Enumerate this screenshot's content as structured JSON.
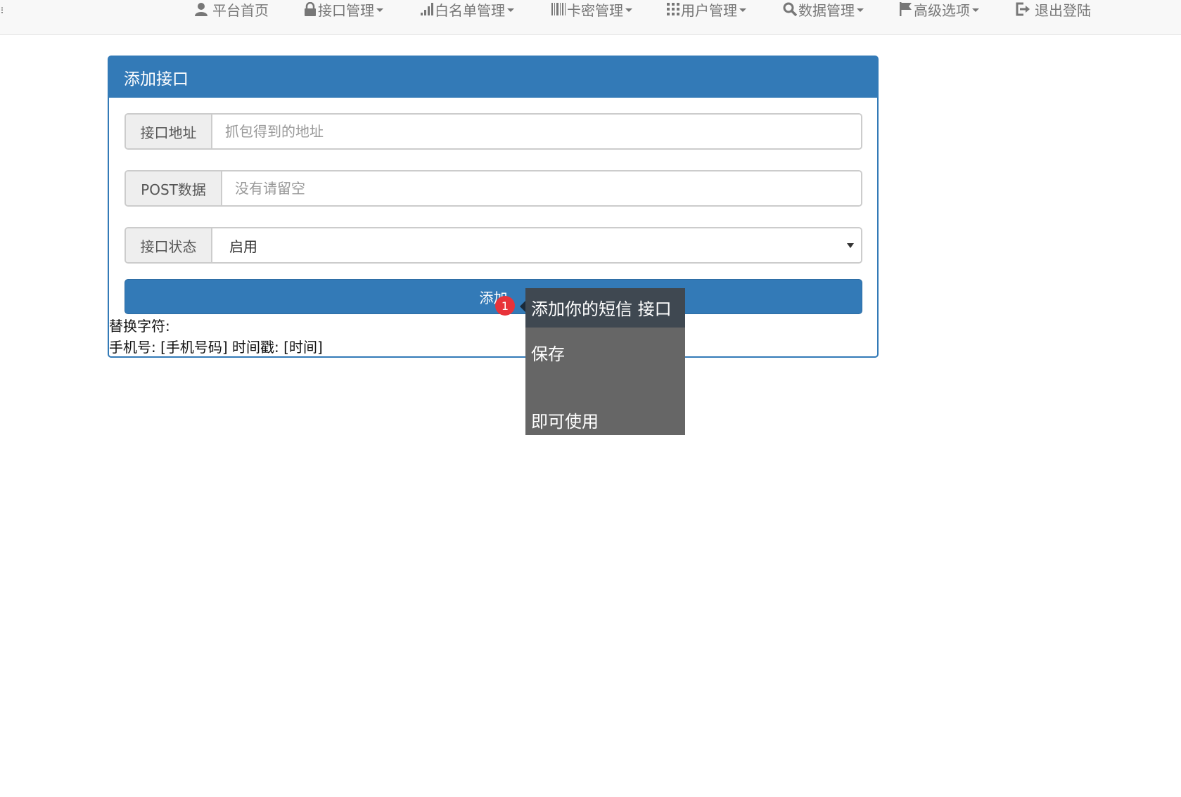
{
  "nav": {
    "items": [
      {
        "label": "平台首页",
        "icon": "user-icon",
        "dropdown": false
      },
      {
        "label": "接口管理",
        "icon": "lock-icon",
        "dropdown": true
      },
      {
        "label": "白名单管理",
        "icon": "signal-icon",
        "dropdown": true
      },
      {
        "label": "卡密管理",
        "icon": "barcode-icon",
        "dropdown": true
      },
      {
        "label": "用户管理",
        "icon": "grid-icon",
        "dropdown": true
      },
      {
        "label": "数据管理",
        "icon": "search-icon",
        "dropdown": true
      },
      {
        "label": "高级选项",
        "icon": "flag-icon",
        "dropdown": true
      },
      {
        "label": "退出登陆",
        "icon": "logout-icon",
        "dropdown": false
      }
    ]
  },
  "panel": {
    "title": "添加接口",
    "url_label": "接口地址",
    "url_placeholder": "抓包得到的地址",
    "post_label": "POST数据",
    "post_placeholder": "没有请留空",
    "status_label": "接口状态",
    "status_value": "启用",
    "add_button": "添加",
    "note_line1": "替换字符:",
    "note_line2": "手机号: [手机号码] 时间戳: [时间]"
  },
  "tooltip": {
    "badge": "1",
    "line1": "添加你的短信 接口",
    "line2": "保存",
    "line3": "即可使用"
  },
  "colors": {
    "primary": "#337ab7",
    "navbar_bg": "#f8f8f8",
    "tooltip_bg": "#666666",
    "badge": "#e8333a"
  }
}
